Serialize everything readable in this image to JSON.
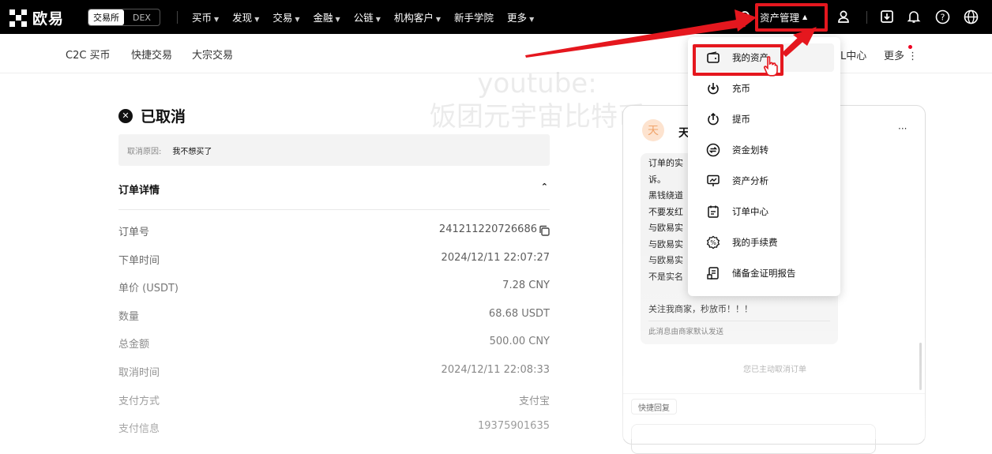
{
  "topnav": {
    "logo_text": "欧易",
    "mode_exchange": "交易所",
    "mode_dex": "DEX",
    "menu": [
      "买币",
      "发现",
      "交易",
      "金融",
      "公链",
      "机构客户",
      "新手学院",
      "更多"
    ],
    "menu_has_caret": [
      true,
      true,
      true,
      true,
      true,
      true,
      false,
      true
    ],
    "asset_management": "资产管理",
    "icons": [
      "search-icon",
      "user-icon",
      "download-icon",
      "bell-icon",
      "help-icon",
      "globe-icon"
    ]
  },
  "subnav": {
    "items": [
      "C2C 买币",
      "快捷交易",
      "大宗交易"
    ],
    "right_partial": "L中心",
    "more": "更多"
  },
  "watermark": {
    "line1": "youtube:",
    "line2": "饭团元宇宙比特币"
  },
  "order": {
    "status": "已取消",
    "cancel_reason_label": "取消原因:",
    "cancel_reason_value": "我不想买了",
    "details_title": "订单详情",
    "rows": [
      {
        "label": "订单号",
        "value": "241211220726686"
      },
      {
        "label": "下单时间",
        "value": "2024/12/11 22:07:27"
      },
      {
        "label": "单价 (USDT)",
        "value": "7.28 CNY"
      },
      {
        "label": "数量",
        "value": "68.68 USDT"
      },
      {
        "label": "总金额",
        "value": "500.00 CNY"
      },
      {
        "label": "取消时间",
        "value": "2024/12/11 22:08:33"
      },
      {
        "label": "支付方式",
        "value": "支付宝"
      },
      {
        "label": "支付信息",
        "value": "19375901635"
      }
    ]
  },
  "chat": {
    "avatar_char": "天",
    "name_partial": "天",
    "more": "···",
    "lines": [
      "订单的实",
      "诉。",
      "黑钱绕道",
      "不要发红",
      "与欧易实",
      "与欧易实",
      "与欧易实",
      "不是实名",
      "",
      "关注我商家，秒放币！！！"
    ],
    "note": "此消息由商家默认发送",
    "system_message": "您已主动取消订单",
    "quick_reply": "快捷回复"
  },
  "dropdown": {
    "items": [
      {
        "label": "我的资产",
        "icon": "wallet-icon"
      },
      {
        "label": "充币",
        "icon": "deposit-icon"
      },
      {
        "label": "提币",
        "icon": "withdraw-icon"
      },
      {
        "label": "资金划转",
        "icon": "transfer-icon"
      },
      {
        "label": "资产分析",
        "icon": "analysis-icon"
      },
      {
        "label": "订单中心",
        "icon": "order-center-icon"
      },
      {
        "label": "我的手续费",
        "icon": "fee-icon"
      },
      {
        "label": "储备金证明报告",
        "icon": "reserve-report-icon"
      }
    ]
  },
  "colors": {
    "annotation_red": "#e5171e",
    "nav_background": "#000000"
  }
}
